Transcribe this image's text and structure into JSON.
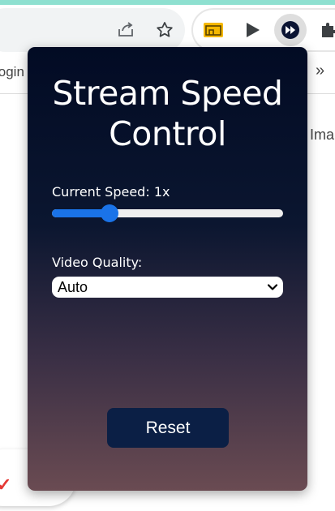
{
  "browser": {
    "bookmark_bar": {
      "left_text": "login",
      "more_label": "»"
    },
    "page_right_text": "Ima",
    "page_check_mark": "✓",
    "icons": [
      "share-icon",
      "star-icon",
      "folder-icon",
      "play-icon",
      "fast-forward-icon",
      "puzzle-icon"
    ]
  },
  "popup": {
    "title": "Stream Speed Control",
    "speed_label": "Current Speed: 1x",
    "speed_slider": {
      "value": 1,
      "fill_fraction": 0.25
    },
    "quality_label": "Video Quality:",
    "quality_selected": "Auto",
    "reset_label": "Reset"
  },
  "colors": {
    "accent": "#1a73e8",
    "popup_top": "#020b24",
    "popup_bottom": "#6a4b52",
    "button_bg": "#0b1f45"
  }
}
